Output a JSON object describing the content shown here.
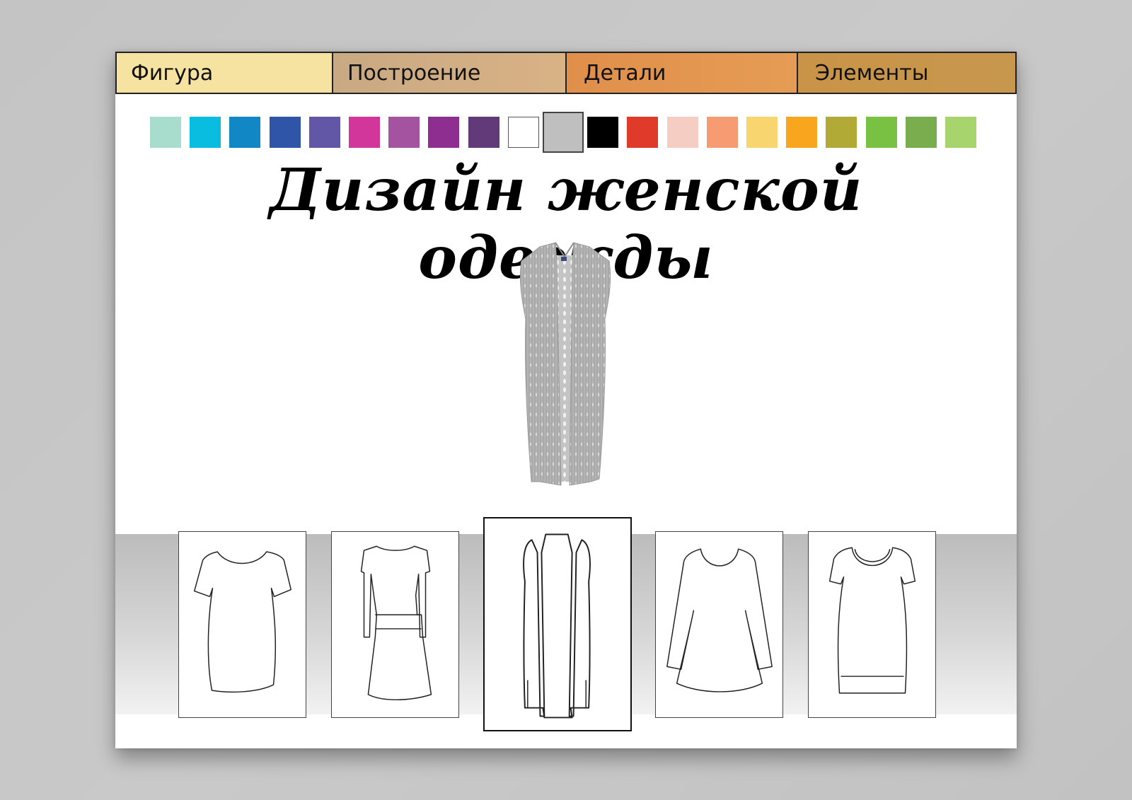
{
  "tabs": [
    {
      "label": "Фигура"
    },
    {
      "label": "Построение"
    },
    {
      "label": "Детали"
    },
    {
      "label": "Элементы"
    }
  ],
  "palette": {
    "colors": [
      "#a8dccc",
      "#09bde0",
      "#1287c6",
      "#2e55a7",
      "#6256a6",
      "#d2369a",
      "#a453a1",
      "#8f2e91",
      "#633a79",
      "#ffffff",
      "#bfbfbf",
      "#000000",
      "#e03a2a",
      "#f6cdc3",
      "#f79c72",
      "#f8d56f",
      "#f8a61e",
      "#b1aa37",
      "#79c142",
      "#7aad4d",
      "#a8d46d"
    ],
    "selected_color": "#bfbfbf"
  },
  "title": "Дизайн женской одежды",
  "preview": {
    "garment": "knitted-long-vest",
    "color": "#bfbfbf"
  },
  "garments": [
    {
      "name": "dress-short-sleeve"
    },
    {
      "name": "dress-long-sleeve-skirt"
    },
    {
      "name": "long-vest",
      "selected": true
    },
    {
      "name": "tunic-long-sleeve"
    },
    {
      "name": "top-short-sleeve"
    }
  ]
}
